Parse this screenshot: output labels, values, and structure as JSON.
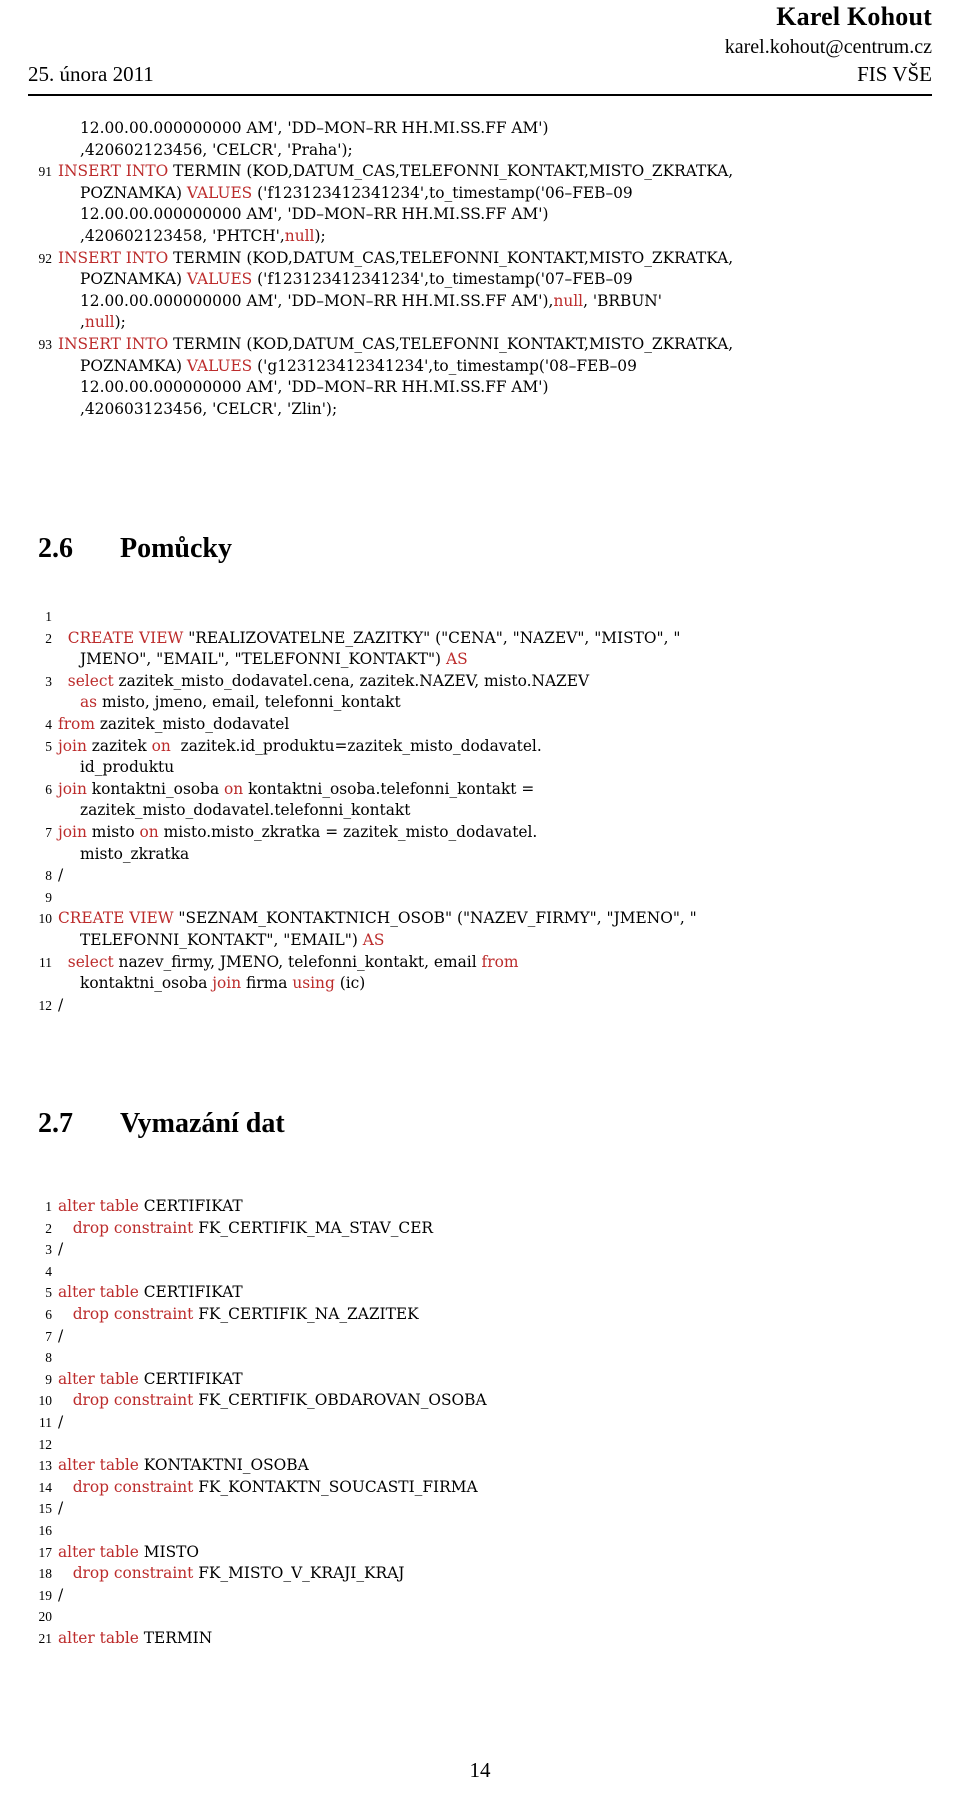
{
  "header": {
    "author": "Karel Kohout",
    "email": "karel.kohout@centrum.cz",
    "date": "25. února 2011",
    "organization": "FIS VŠE"
  },
  "footer": {
    "page_number": "14"
  },
  "listings": [
    {
      "id": "insert-termin-listing",
      "lines": [
        {
          "num": "",
          "segments": [
            {
              "t": "12.00.00.000000000 AM', 'DD–MON–RR HH.MI.SS.FF AM')",
              "c": "plain",
              "indent": true
            }
          ]
        },
        {
          "num": "",
          "segments": [
            {
              "t": ",420602123456, 'CELCR', 'Praha');",
              "c": "plain",
              "indent": true
            }
          ]
        },
        {
          "num": "91",
          "segments": [
            {
              "t": "INSERT INTO",
              "c": "kw"
            },
            {
              "t": " TERMIN (KOD,DATUM_CAS,TELEFONNI_KONTAKT,MISTO_ZKRATKA,",
              "c": "plain"
            }
          ]
        },
        {
          "num": "",
          "segments": [
            {
              "t": "POZNAMKA) ",
              "c": "plain",
              "indent": true
            },
            {
              "t": "VALUES",
              "c": "kw"
            },
            {
              "t": " ('f123123412341234',to_timestamp('06–FEB–09",
              "c": "plain"
            }
          ]
        },
        {
          "num": "",
          "segments": [
            {
              "t": "12.00.00.000000000 AM', 'DD–MON–RR HH.MI.SS.FF AM')",
              "c": "plain",
              "indent": true
            }
          ]
        },
        {
          "num": "",
          "segments": [
            {
              "t": ",420602123458, 'PHTCH',",
              "c": "plain",
              "indent": true
            },
            {
              "t": "null",
              "c": "kw"
            },
            {
              "t": ");",
              "c": "plain"
            }
          ]
        },
        {
          "num": "92",
          "segments": [
            {
              "t": "INSERT INTO",
              "c": "kw"
            },
            {
              "t": " TERMIN (KOD,DATUM_CAS,TELEFONNI_KONTAKT,MISTO_ZKRATKA,",
              "c": "plain"
            }
          ]
        },
        {
          "num": "",
          "segments": [
            {
              "t": "POZNAMKA) ",
              "c": "plain",
              "indent": true
            },
            {
              "t": "VALUES",
              "c": "kw"
            },
            {
              "t": " ('f123123412341234',to_timestamp('07–FEB–09",
              "c": "plain"
            }
          ]
        },
        {
          "num": "",
          "segments": [
            {
              "t": "12.00.00.000000000 AM', 'DD–MON–RR HH.MI.SS.FF AM'),",
              "c": "plain",
              "indent": true
            },
            {
              "t": "null",
              "c": "kw"
            },
            {
              "t": ", 'BRBUN'",
              "c": "plain"
            }
          ]
        },
        {
          "num": "",
          "segments": [
            {
              "t": ",",
              "c": "plain",
              "indent": true
            },
            {
              "t": "null",
              "c": "kw"
            },
            {
              "t": ");",
              "c": "plain"
            }
          ]
        },
        {
          "num": "93",
          "segments": [
            {
              "t": "INSERT INTO",
              "c": "kw"
            },
            {
              "t": " TERMIN (KOD,DATUM_CAS,TELEFONNI_KONTAKT,MISTO_ZKRATKA,",
              "c": "plain"
            }
          ]
        },
        {
          "num": "",
          "segments": [
            {
              "t": "POZNAMKA) ",
              "c": "plain",
              "indent": true
            },
            {
              "t": "VALUES",
              "c": "kw"
            },
            {
              "t": " ('g123123412341234',to_timestamp('08–FEB–09",
              "c": "plain"
            }
          ]
        },
        {
          "num": "",
          "segments": [
            {
              "t": "12.00.00.000000000 AM', 'DD–MON–RR HH.MI.SS.FF AM')",
              "c": "plain",
              "indent": true
            }
          ]
        },
        {
          "num": "",
          "segments": [
            {
              "t": ",420603123456, 'CELCR', 'Zlin');",
              "c": "plain",
              "indent": true
            }
          ]
        }
      ]
    },
    {
      "id": "create-view-listing",
      "lines": [
        {
          "num": "1",
          "segments": []
        },
        {
          "num": "2",
          "segments": [
            {
              "t": "  CREATE VIEW",
              "c": "kw"
            },
            {
              "t": " \"REALIZOVATELNE_ZAZITKY\" (\"CENA\", \"NAZEV\", \"MISTO\", \"",
              "c": "plain"
            }
          ]
        },
        {
          "num": "",
          "segments": [
            {
              "t": "JMENO\", \"EMAIL\", \"TELEFONNI_KONTAKT\") ",
              "c": "plain",
              "indent": true
            },
            {
              "t": "AS",
              "c": "kw"
            }
          ]
        },
        {
          "num": "3",
          "segments": [
            {
              "t": "  select",
              "c": "kw"
            },
            {
              "t": " zazitek_misto_dodavatel.cena, zazitek.NAZEV, misto.NAZEV",
              "c": "plain"
            }
          ]
        },
        {
          "num": "",
          "segments": [
            {
              "t": "as",
              "c": "kw",
              "indent": true
            },
            {
              "t": " misto, jmeno, email, telefonni_kontakt",
              "c": "plain"
            }
          ]
        },
        {
          "num": "4",
          "segments": [
            {
              "t": "from",
              "c": "kw"
            },
            {
              "t": " zazitek_misto_dodavatel",
              "c": "plain"
            }
          ]
        },
        {
          "num": "5",
          "segments": [
            {
              "t": "join",
              "c": "kw"
            },
            {
              "t": " zazitek ",
              "c": "plain"
            },
            {
              "t": "on",
              "c": "kw"
            },
            {
              "t": "  zazitek.id_produktu=zazitek_misto_dodavatel.",
              "c": "plain"
            }
          ]
        },
        {
          "num": "",
          "segments": [
            {
              "t": "id_produktu",
              "c": "plain",
              "indent": true
            }
          ]
        },
        {
          "num": "6",
          "segments": [
            {
              "t": "join",
              "c": "kw"
            },
            {
              "t": " kontaktni_osoba ",
              "c": "plain"
            },
            {
              "t": "on",
              "c": "kw"
            },
            {
              "t": " kontaktni_osoba.telefonni_kontakt =",
              "c": "plain"
            }
          ]
        },
        {
          "num": "",
          "segments": [
            {
              "t": "zazitek_misto_dodavatel.telefonni_kontakt",
              "c": "plain",
              "indent": true
            }
          ]
        },
        {
          "num": "7",
          "segments": [
            {
              "t": "join",
              "c": "kw"
            },
            {
              "t": " misto ",
              "c": "plain"
            },
            {
              "t": "on",
              "c": "kw"
            },
            {
              "t": " misto.misto_zkratka = zazitek_misto_dodavatel.",
              "c": "plain"
            }
          ]
        },
        {
          "num": "",
          "segments": [
            {
              "t": "misto_zkratka",
              "c": "plain",
              "indent": true
            }
          ]
        },
        {
          "num": "8",
          "segments": [
            {
              "t": "/",
              "c": "plain"
            }
          ]
        },
        {
          "num": "9",
          "segments": []
        },
        {
          "num": "10",
          "segments": [
            {
              "t": "CREATE VIEW",
              "c": "kw"
            },
            {
              "t": " \"SEZNAM_KONTAKTNICH_OSOB\" (\"NAZEV_FIRMY\", \"JMENO\", \"",
              "c": "plain"
            }
          ]
        },
        {
          "num": "",
          "segments": [
            {
              "t": "TELEFONNI_KONTAKT\", \"EMAIL\") ",
              "c": "plain",
              "indent": true
            },
            {
              "t": "AS",
              "c": "kw"
            }
          ]
        },
        {
          "num": "11",
          "segments": [
            {
              "t": "  select",
              "c": "kw"
            },
            {
              "t": " nazev_firmy, JMENO, telefonni_kontakt, email ",
              "c": "plain"
            },
            {
              "t": "from",
              "c": "kw"
            }
          ]
        },
        {
          "num": "",
          "segments": [
            {
              "t": "kontaktni_osoba ",
              "c": "plain",
              "indent": true
            },
            {
              "t": "join",
              "c": "kw"
            },
            {
              "t": " firma ",
              "c": "plain"
            },
            {
              "t": "using",
              "c": "kw"
            },
            {
              "t": " (ic)",
              "c": "plain"
            }
          ]
        },
        {
          "num": "12",
          "segments": [
            {
              "t": "/",
              "c": "plain"
            }
          ]
        }
      ]
    },
    {
      "id": "drop-constraints-listing",
      "lines": [
        {
          "num": "1",
          "segments": [
            {
              "t": "alter table",
              "c": "kw"
            },
            {
              "t": " CERTIFIKAT",
              "c": "plain"
            }
          ]
        },
        {
          "num": "2",
          "segments": [
            {
              "t": "   drop constraint",
              "c": "kw"
            },
            {
              "t": " FK_CERTIFIK_MA_STAV_CER",
              "c": "plain"
            }
          ]
        },
        {
          "num": "3",
          "segments": [
            {
              "t": "/",
              "c": "plain"
            }
          ]
        },
        {
          "num": "4",
          "segments": []
        },
        {
          "num": "5",
          "segments": [
            {
              "t": "alter table",
              "c": "kw"
            },
            {
              "t": " CERTIFIKAT",
              "c": "plain"
            }
          ]
        },
        {
          "num": "6",
          "segments": [
            {
              "t": "   drop constraint",
              "c": "kw"
            },
            {
              "t": " FK_CERTIFIK_NA_ZAZITEK",
              "c": "plain"
            }
          ]
        },
        {
          "num": "7",
          "segments": [
            {
              "t": "/",
              "c": "plain"
            }
          ]
        },
        {
          "num": "8",
          "segments": []
        },
        {
          "num": "9",
          "segments": [
            {
              "t": "alter table",
              "c": "kw"
            },
            {
              "t": " CERTIFIKAT",
              "c": "plain"
            }
          ]
        },
        {
          "num": "10",
          "segments": [
            {
              "t": "   drop constraint",
              "c": "kw"
            },
            {
              "t": " FK_CERTIFIK_OBDAROVAN_OSOBA",
              "c": "plain"
            }
          ]
        },
        {
          "num": "11",
          "segments": [
            {
              "t": "/",
              "c": "plain"
            }
          ]
        },
        {
          "num": "12",
          "segments": []
        },
        {
          "num": "13",
          "segments": [
            {
              "t": "alter table",
              "c": "kw"
            },
            {
              "t": " KONTAKTNI_OSOBA",
              "c": "plain"
            }
          ]
        },
        {
          "num": "14",
          "segments": [
            {
              "t": "   drop constraint",
              "c": "kw"
            },
            {
              "t": " FK_KONTAKTN_SOUCASTI_FIRMA",
              "c": "plain"
            }
          ]
        },
        {
          "num": "15",
          "segments": [
            {
              "t": "/",
              "c": "plain"
            }
          ]
        },
        {
          "num": "16",
          "segments": []
        },
        {
          "num": "17",
          "segments": [
            {
              "t": "alter table",
              "c": "kw"
            },
            {
              "t": " MISTO",
              "c": "plain"
            }
          ]
        },
        {
          "num": "18",
          "segments": [
            {
              "t": "   drop constraint",
              "c": "kw"
            },
            {
              "t": " FK_MISTO_V_KRAJI_KRAJ",
              "c": "plain"
            }
          ]
        },
        {
          "num": "19",
          "segments": [
            {
              "t": "/",
              "c": "plain"
            }
          ]
        },
        {
          "num": "20",
          "segments": []
        },
        {
          "num": "21",
          "segments": [
            {
              "t": "alter table",
              "c": "kw"
            },
            {
              "t": " TERMIN",
              "c": "plain"
            }
          ]
        }
      ]
    }
  ],
  "sections": [
    {
      "id": "section-2-6",
      "number": "2.6",
      "title": "Pomůcky"
    },
    {
      "id": "section-2-7",
      "number": "2.7",
      "title": "Vymazání dat"
    }
  ],
  "colors": {
    "keyword_red": "#BC2B2B",
    "text_black": "#000000",
    "page_background": "#FFFFFF"
  }
}
